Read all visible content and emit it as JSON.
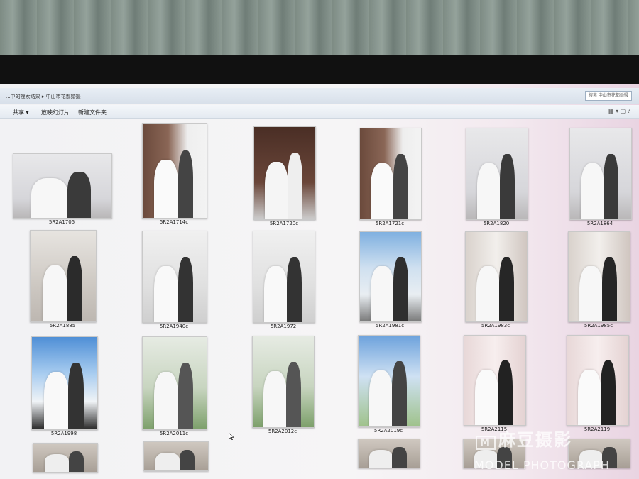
{
  "explorer": {
    "address_path": "...中的搜索结果 ▸ 中山市花都婚摄",
    "search_placeholder": "搜索 中山市花都婚摄",
    "toolbar": {
      "share": "共享 ▾",
      "slideshow": "放映幻灯片",
      "new_folder": "新建文件夹"
    }
  },
  "files": [
    {
      "name": "5R2A1705",
      "style": "church"
    },
    {
      "name": "5R2A1714c",
      "style": "door"
    },
    {
      "name": "5R2A1720c",
      "style": "dark-door"
    },
    {
      "name": "5R2A1721c",
      "style": "door"
    },
    {
      "name": "5R2A1820",
      "style": "church"
    },
    {
      "name": "5R2A1864",
      "style": "church"
    },
    {
      "name": "5R2A1885",
      "style": "arch"
    },
    {
      "name": "5R2A1940c",
      "style": "outdoor-white"
    },
    {
      "name": "5R2A1972",
      "style": "outdoor-white"
    },
    {
      "name": "5R2A1981c",
      "style": "sky-church"
    },
    {
      "name": "5R2A1983c",
      "style": "pillar"
    },
    {
      "name": "5R2A1985c",
      "style": "pillar"
    },
    {
      "name": "5R2A1998",
      "style": "sky-car"
    },
    {
      "name": "5R2A2011c",
      "style": "garden"
    },
    {
      "name": "5R2A2012c",
      "style": "garden"
    },
    {
      "name": "5R2A2019c",
      "style": "sky-garden"
    },
    {
      "name": "5R2A2115",
      "style": "curtain"
    },
    {
      "name": "5R2A2119",
      "style": "curtain"
    },
    {
      "name": "",
      "style": "partial"
    },
    {
      "name": "",
      "style": "partial"
    },
    {
      "name": "",
      "style": "partial"
    },
    {
      "name": "",
      "style": "partial"
    },
    {
      "name": "",
      "style": "partial"
    }
  ],
  "watermark": {
    "logo": "麻豆摄影",
    "text": "MODEL PHOTOGRAPH"
  }
}
